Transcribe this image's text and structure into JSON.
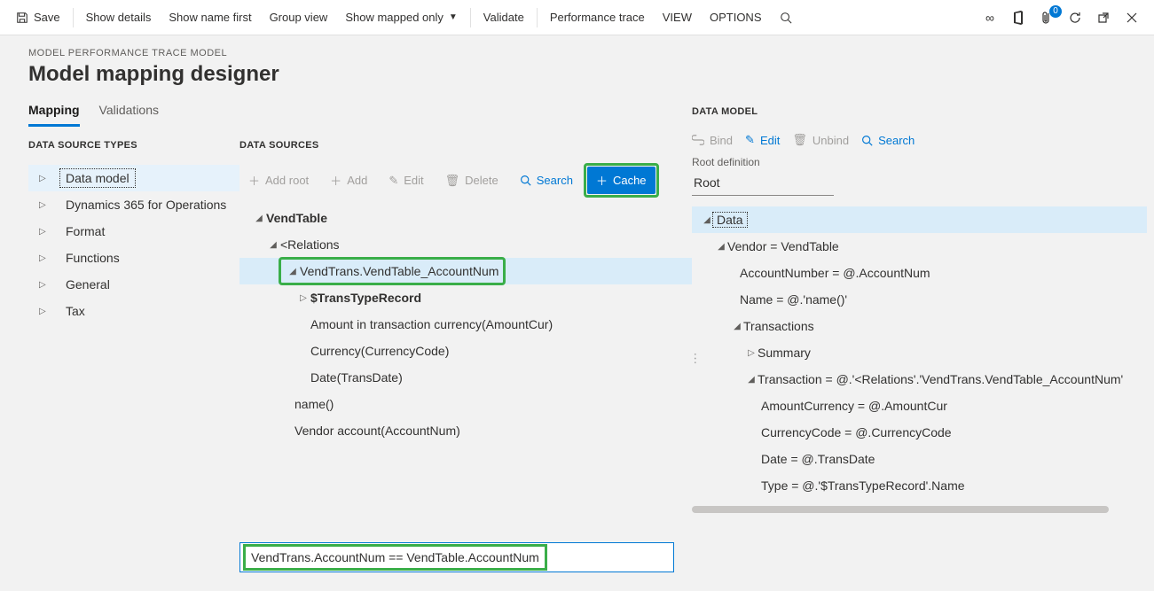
{
  "topbar": {
    "save": "Save",
    "showDetails": "Show details",
    "showNameFirst": "Show name first",
    "groupView": "Group view",
    "showMappedOnly": "Show mapped only",
    "validate": "Validate",
    "perfTrace": "Performance trace",
    "view": "VIEW",
    "options": "OPTIONS",
    "badgeCount": "0"
  },
  "header": {
    "breadcrumb": "MODEL PERFORMANCE TRACE MODEL",
    "title": "Model mapping designer"
  },
  "tabs": {
    "mapping": "Mapping",
    "validations": "Validations"
  },
  "left": {
    "heading": "DATA SOURCE TYPES",
    "items": [
      "Data model",
      "Dynamics 365 for Operations",
      "Format",
      "Functions",
      "General",
      "Tax"
    ]
  },
  "mid": {
    "heading": "DATA SOURCES",
    "toolbar": {
      "addRoot": "Add root",
      "add": "Add",
      "edit": "Edit",
      "delete": "Delete",
      "search": "Search",
      "cache": "Cache"
    },
    "tree": {
      "root": "VendTable",
      "relations": "<Relations",
      "vendTrans": "VendTrans.VendTable_AccountNum",
      "trans": "$TransTypeRecord",
      "amount": "Amount in transaction currency(AmountCur)",
      "currency": "Currency(CurrencyCode)",
      "date": "Date(TransDate)",
      "name": "name()",
      "vendor": "Vendor account(AccountNum)"
    }
  },
  "right": {
    "heading": "DATA MODEL",
    "toolbar": {
      "bind": "Bind",
      "edit": "Edit",
      "unbind": "Unbind",
      "search": "Search"
    },
    "rootLabel": "Root definition",
    "rootValue": "Root",
    "tree": {
      "data": "Data",
      "vendor": "Vendor = VendTable",
      "account": "AccountNumber = @.AccountNum",
      "name": "Name = @.'name()'",
      "transactions": "Transactions",
      "summary": "Summary",
      "transaction": "Transaction = @.'<Relations'.'VendTrans.VendTable_AccountNum'",
      "amountCur": "AmountCurrency = @.AmountCur",
      "currencyCode": "CurrencyCode = @.CurrencyCode",
      "dateEq": "Date = @.TransDate",
      "typeEq": "Type = @.'$TransTypeRecord'.Name"
    }
  },
  "expr": "VendTrans.AccountNum == VendTable.AccountNum"
}
